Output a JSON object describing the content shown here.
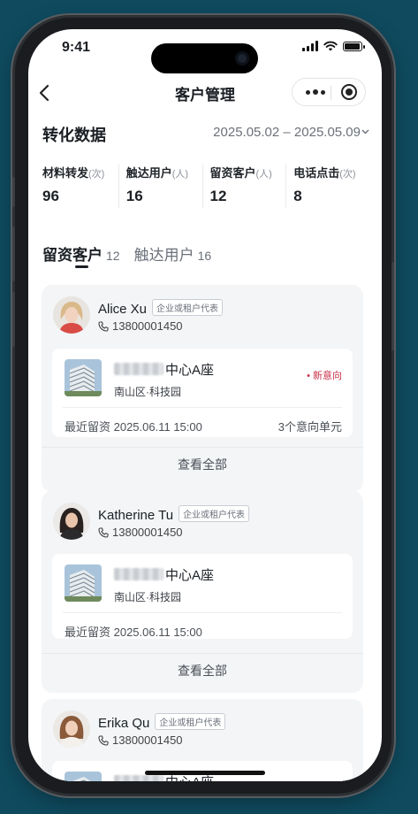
{
  "status_bar": {
    "time": "9:41"
  },
  "nav": {
    "back_glyph": "‹",
    "title": "客户管理"
  },
  "conversion": {
    "title": "转化数据",
    "date_range": "2025.05.02 – 2025.05.09",
    "stats": [
      {
        "label": "材料转发",
        "unit": "(次)",
        "value": "96"
      },
      {
        "label": "触达用户",
        "unit": "(人)",
        "value": "16"
      },
      {
        "label": "留资客户",
        "unit": "(人)",
        "value": "12"
      },
      {
        "label": "电话点击",
        "unit": "(次)",
        "value": "8"
      }
    ]
  },
  "tabs": [
    {
      "label": "留资客户",
      "count": "12",
      "active": true
    },
    {
      "label": "触达用户",
      "count": "16",
      "active": false
    }
  ],
  "customers": [
    {
      "name": "Alice Xu",
      "tag": "企业或租户代表",
      "phone": "13800001450",
      "property_name": "中心A座",
      "property_area": "南山区·科技园",
      "intent": "新意向",
      "last_visit": "最近留资 2025.06.11 15:00",
      "units": "3个意向单元",
      "view_all": "查看全部"
    },
    {
      "name": "Katherine Tu",
      "tag": "企业或租户代表",
      "phone": "13800001450",
      "property_name": "中心A座",
      "property_area": "南山区·科技园",
      "last_visit": "最近留资 2025.06.11 15:00",
      "view_all": "查看全部"
    },
    {
      "name": "Erika Qu",
      "tag": "企业或租户代表",
      "phone": "13800001450",
      "property_name": "中心A座"
    }
  ]
}
